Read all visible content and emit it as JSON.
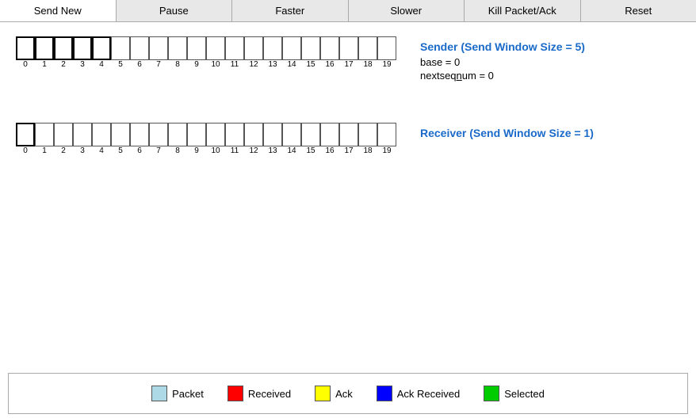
{
  "toolbar": {
    "buttons": [
      {
        "label": "Send New",
        "active": true
      },
      {
        "label": "Pause",
        "active": false
      },
      {
        "label": "Faster",
        "active": false
      },
      {
        "label": "Slower",
        "active": false
      },
      {
        "label": "Kill Packet/Ack",
        "active": false
      },
      {
        "label": "Reset",
        "active": false
      }
    ]
  },
  "sender": {
    "title": "Sender (Send Window Size = 5)",
    "base_label": "base = 0",
    "nextseqnum_label": "nextseqnum = 0",
    "total_packets": 20,
    "window_size": 5
  },
  "receiver": {
    "title": "Receiver (Send Window Size = 1)",
    "total_packets": 20,
    "window_size": 1
  },
  "legend": {
    "items": [
      {
        "label": "Packet",
        "color": "#add8e6"
      },
      {
        "label": "Received",
        "color": "#ff0000"
      },
      {
        "label": "Ack",
        "color": "#ffff00"
      },
      {
        "label": "Ack Received",
        "color": "#0000ff"
      },
      {
        "label": "Selected",
        "color": "#00cc00"
      }
    ]
  }
}
